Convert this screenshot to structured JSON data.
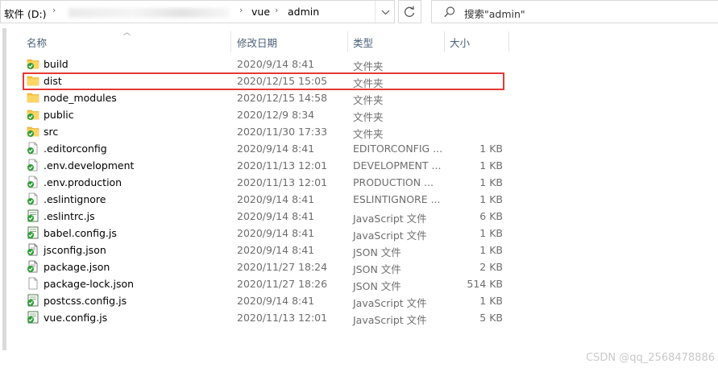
{
  "address_bar": {
    "drive": "软件 (D:)",
    "folder1": "vue",
    "folder2": "admin"
  },
  "search": {
    "placeholder": "搜索\"admin\""
  },
  "columns": {
    "name": "名称",
    "date": "修改日期",
    "type": "类型",
    "size": "大小"
  },
  "files": [
    {
      "name": "build",
      "date": "2020/9/14 8:41",
      "type": "文件夹",
      "size": "",
      "icon": "folder-synced-icon"
    },
    {
      "name": "dist",
      "date": "2020/12/15 15:05",
      "type": "文件夹",
      "size": "",
      "icon": "folder-icon"
    },
    {
      "name": "node_modules",
      "date": "2020/12/15 14:58",
      "type": "文件夹",
      "size": "",
      "icon": "folder-icon"
    },
    {
      "name": "public",
      "date": "2020/12/9 8:34",
      "type": "文件夹",
      "size": "",
      "icon": "folder-synced-icon"
    },
    {
      "name": "src",
      "date": "2020/11/30 17:33",
      "type": "文件夹",
      "size": "",
      "icon": "folder-synced-icon"
    },
    {
      "name": ".editorconfig",
      "date": "2020/9/14 8:41",
      "type": "EDITORCONFIG ...",
      "size": "1 KB",
      "icon": "file-synced-icon"
    },
    {
      "name": ".env.development",
      "date": "2020/11/13 12:01",
      "type": "DEVELOPMENT ...",
      "size": "1 KB",
      "icon": "file-synced-icon"
    },
    {
      "name": ".env.production",
      "date": "2020/11/13 12:01",
      "type": "PRODUCTION ...",
      "size": "1 KB",
      "icon": "file-synced-icon"
    },
    {
      "name": ".eslintignore",
      "date": "2020/9/14 8:41",
      "type": "ESLINTIGNORE ...",
      "size": "1 KB",
      "icon": "file-synced-icon"
    },
    {
      "name": ".eslintrc.js",
      "date": "2020/9/14 8:41",
      "type": "JavaScript 文件",
      "size": "6 KB",
      "icon": "js-file-synced-icon"
    },
    {
      "name": "babel.config.js",
      "date": "2020/9/14 8:41",
      "type": "JavaScript 文件",
      "size": "1 KB",
      "icon": "js-file-synced-icon"
    },
    {
      "name": "jsconfig.json",
      "date": "2020/9/14 8:41",
      "type": "JSON 文件",
      "size": "1 KB",
      "icon": "json-file-synced-icon"
    },
    {
      "name": "package.json",
      "date": "2020/11/27 18:24",
      "type": "JSON 文件",
      "size": "2 KB",
      "icon": "json-file-synced-icon"
    },
    {
      "name": "package-lock.json",
      "date": "2020/11/27 18:26",
      "type": "JSON 文件",
      "size": "514 KB",
      "icon": "file-icon"
    },
    {
      "name": "postcss.config.js",
      "date": "2020/9/14 8:41",
      "type": "JavaScript 文件",
      "size": "1 KB",
      "icon": "js-file-synced-icon"
    },
    {
      "name": "vue.config.js",
      "date": "2020/11/13 12:01",
      "type": "JavaScript 文件",
      "size": "5 KB",
      "icon": "js-file-synced-icon"
    }
  ],
  "watermark": "CSDN @qq_2568478886",
  "colors": {
    "highlight": "#e53935",
    "folder": "#f5c142",
    "sync_badge": "#2e9e36",
    "header_text": "#4c607a"
  }
}
